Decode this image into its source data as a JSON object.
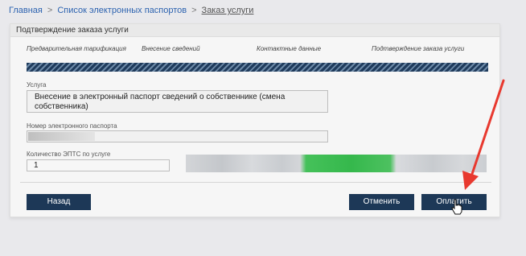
{
  "breadcrumb": {
    "items": [
      "Главная",
      "Список электронных паспортов",
      "Заказ услуги"
    ],
    "separator": ">"
  },
  "panel": {
    "title": "Подтверждение заказа услуги"
  },
  "steps": [
    "Предварительная тарификация",
    "Внесение сведений",
    "Контактные данные",
    "Подтверждение заказа услуги"
  ],
  "progress": {
    "completed_fraction": 1.0
  },
  "fields": {
    "service_label": "Услуга",
    "service_value": "Внесение в электронный паспорт сведений о собственнике (смена собственника)",
    "passport_label": "Номер электронного паспорта",
    "count_label": "Количество ЭПТС по услуге",
    "count_value": "1"
  },
  "buttons": {
    "back": "Назад",
    "cancel": "Отменить",
    "pay": "Оплатить"
  },
  "annotation": {
    "arrow_color": "#e8392f"
  },
  "colors": {
    "accent_dark": "#1d3857",
    "link": "#2d63b0"
  }
}
